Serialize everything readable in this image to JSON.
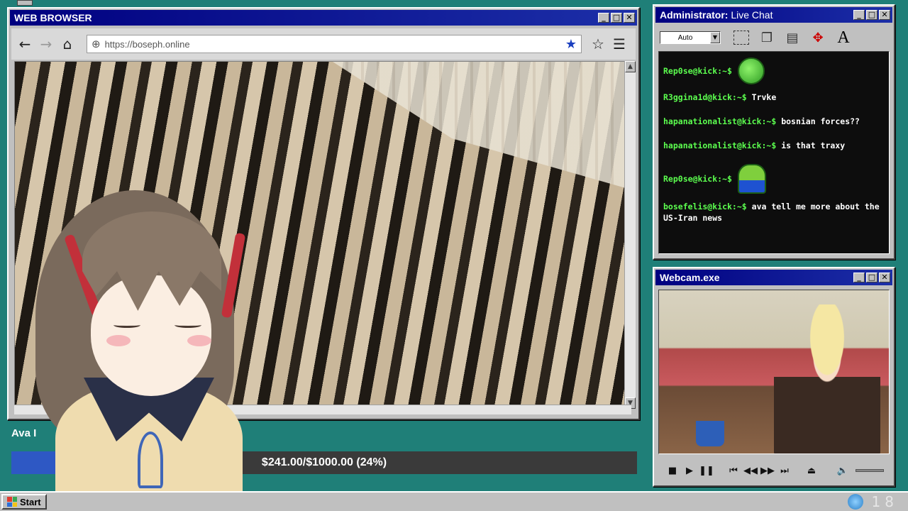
{
  "browser": {
    "title": "WEB BROWSER",
    "url": "https://boseph.online",
    "nav": {
      "back": "back-arrow",
      "forward": "forward-arrow",
      "home": "home-icon"
    }
  },
  "chat": {
    "title_admin": "Administrator:",
    "title_rest": " Live Chat",
    "select_value": "Auto",
    "messages": [
      {
        "user": "Rep0se@kick:~$",
        "text": "",
        "emote": "green-smile-emote"
      },
      {
        "user": "R3ggina1d@kick:~$",
        "text": "Trvke"
      },
      {
        "user": "hapanationalist@kick:~$",
        "text": "bosnian forces??"
      },
      {
        "user": "hapanationalist@kick:~$",
        "text": "is that traxy"
      },
      {
        "user": "Rep0se@kick:~$",
        "text": "",
        "emote": "frog-emote"
      },
      {
        "user": "bosefelis@kick:~$",
        "text": "ava tell me more about the US-Iran news"
      }
    ]
  },
  "webcam": {
    "title": "Webcam.exe"
  },
  "donation": {
    "label": "Ava I",
    "text": "$241.00/$1000.00 (24%)",
    "progress": 0.24,
    "fill_color": "#2e58c4"
  },
  "taskbar": {
    "start_label": "Start",
    "clock": "18"
  },
  "colors": {
    "desktop": "#1f7f78",
    "titlebar": "#000080",
    "chat_user": "#5cff4f"
  }
}
